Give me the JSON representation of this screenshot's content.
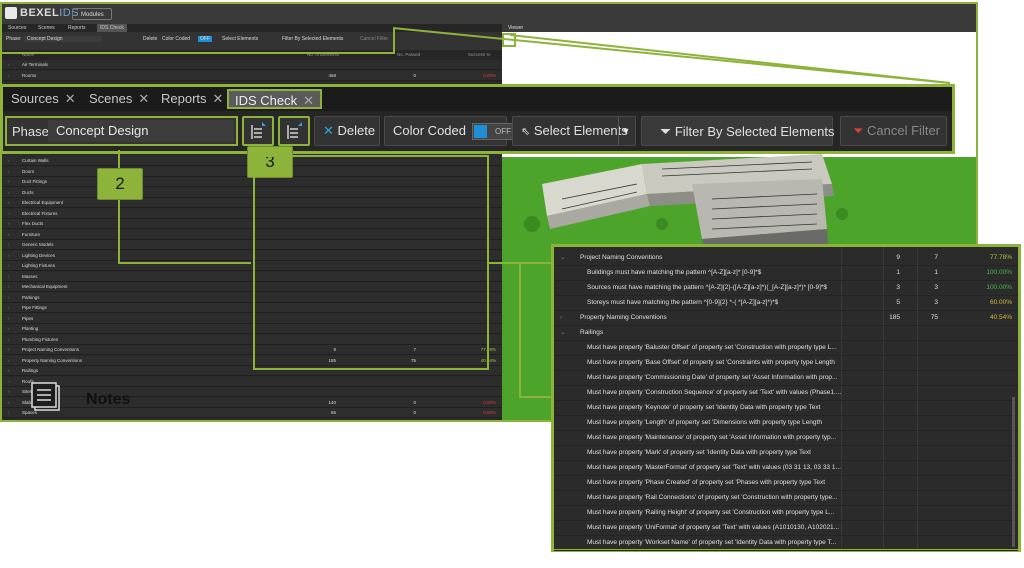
{
  "app": {
    "logo_main": "BEXEL",
    "logo_sub": "IDS",
    "module_button": "Modules",
    "small_tabs": [
      "Sources",
      "Scenes",
      "Reports",
      "IDS Check"
    ],
    "viewer_tab": "Viewer",
    "small_toolbar": {
      "phase_label": "Phase:",
      "phase_value": "Concept Design",
      "delete": "Delete",
      "color_coded": "Color Coded",
      "off": "OFF",
      "select_elements": "Select Elements",
      "filter": "Filter By Selected Elements",
      "cancel_filter": "Cancel Filter"
    },
    "small_header": {
      "name": "Name",
      "elements": "No. of Elements",
      "passed": "No. Passed",
      "success": "Success %"
    },
    "top_rows": [
      {
        "label": "Air Terminals",
        "a": "",
        "b": "",
        "p": ""
      },
      {
        "label": "Rooms",
        "a": "468",
        "b": "0",
        "p": "0.00%"
      }
    ],
    "categories": [
      {
        "label": "Curtain Walls",
        "a": "",
        "b": "",
        "p": ""
      },
      {
        "label": "Doors",
        "a": "",
        "b": "",
        "p": ""
      },
      {
        "label": "Duct Fittings",
        "a": "",
        "b": "",
        "p": ""
      },
      {
        "label": "Ducts",
        "a": "",
        "b": "",
        "p": ""
      },
      {
        "label": "Electrical Equipment",
        "a": "",
        "b": "",
        "p": ""
      },
      {
        "label": "Electrical Fixtures",
        "a": "",
        "b": "",
        "p": ""
      },
      {
        "label": "Flex Ducts",
        "a": "",
        "b": "",
        "p": ""
      },
      {
        "label": "Furniture",
        "a": "",
        "b": "",
        "p": ""
      },
      {
        "label": "Generic Models",
        "a": "",
        "b": "",
        "p": ""
      },
      {
        "label": "Lighting Devices",
        "a": "",
        "b": "",
        "p": ""
      },
      {
        "label": "Lighting Fixtures",
        "a": "",
        "b": "",
        "p": ""
      },
      {
        "label": "Masses",
        "a": "",
        "b": "",
        "p": ""
      },
      {
        "label": "Mechanical Equipment",
        "a": "",
        "b": "",
        "p": ""
      },
      {
        "label": "Parkings",
        "a": "",
        "b": "",
        "p": ""
      },
      {
        "label": "Pipe Fittings",
        "a": "",
        "b": "",
        "p": ""
      },
      {
        "label": "Pipes",
        "a": "",
        "b": "",
        "p": ""
      },
      {
        "label": "Planting",
        "a": "",
        "b": "",
        "p": ""
      },
      {
        "label": "Plumbing Fixtures",
        "a": "",
        "b": "",
        "p": ""
      },
      {
        "label": "Project Naming Conventions",
        "a": "9",
        "b": "7",
        "p": "77.78%"
      },
      {
        "label": "Property Naming Conventions",
        "a": "185",
        "b": "75",
        "p": "40.54%"
      },
      {
        "label": "Railings",
        "a": "",
        "b": "",
        "p": ""
      },
      {
        "label": "Roofs",
        "a": "",
        "b": "",
        "p": ""
      },
      {
        "label": "Sites",
        "a": "",
        "b": "",
        "p": ""
      },
      {
        "label": "Slabs",
        "a": "140",
        "b": "0",
        "p": "0.00%"
      },
      {
        "label": "Spaces",
        "a": "65",
        "b": "0",
        "p": "0.00%"
      }
    ]
  },
  "toolbar": {
    "tabs": [
      "Sources",
      "Scenes",
      "Reports",
      "IDS Check"
    ],
    "phase_label": "Phase:",
    "phase_value": "Concept Design",
    "delete": "Delete",
    "color_coded": "Color Coded",
    "toggle_state": "OFF",
    "select_elements": "Select Elements",
    "filter": "Filter By Selected Elements",
    "cancel_filter": "Cancel Filter"
  },
  "callouts": {
    "two": "2",
    "three": "3"
  },
  "panel": {
    "rows": [
      {
        "indent": 0,
        "label": "Project Naming Conventions",
        "a": "9",
        "b": "7",
        "p": "77.78%",
        "pcolor": "#a6c83c"
      },
      {
        "indent": 1,
        "label": "Buildings must have matching the pattern ^[A-Z][a-z]* [0-9]*$",
        "a": "1",
        "b": "1",
        "p": "100.00%",
        "pcolor": "#4cb748"
      },
      {
        "indent": 1,
        "label": "Sources must have matching the pattern ^[A-Z]{2}-([A-Z][a-z]*)(_[A-Z][a-z]*)* [0-9]*$",
        "a": "3",
        "b": "3",
        "p": "100.00%",
        "pcolor": "#4cb748"
      },
      {
        "indent": 1,
        "label": "Storeys must have matching the pattern ^[0-9]{2} *-( *[A-Z][a-z]*)*$",
        "a": "5",
        "b": "3",
        "p": "60.00%",
        "pcolor": "#d6b93a"
      },
      {
        "indent": 0,
        "label": "Property Naming Conventions",
        "a": "185",
        "b": "75",
        "p": "40.54%",
        "pcolor": "#d6b93a"
      },
      {
        "indent": 0,
        "label": "Railings",
        "a": "",
        "b": "",
        "p": "",
        "pcolor": "#ffffff"
      },
      {
        "indent": 1,
        "label": "Must have property 'Baluster Offset' of property set 'Construction with property type L...",
        "a": "",
        "b": "",
        "p": "",
        "pcolor": "#ffffff"
      },
      {
        "indent": 1,
        "label": "Must have property 'Base Offset' of property set 'Constraints with property type Length",
        "a": "",
        "b": "",
        "p": "",
        "pcolor": "#ffffff"
      },
      {
        "indent": 1,
        "label": "Must have property 'Commissioning Date' of property set 'Asset Information with prop...",
        "a": "",
        "b": "",
        "p": "",
        "pcolor": "#ffffff"
      },
      {
        "indent": 1,
        "label": "Must have property 'Construction Sequence' of property set 'Text' with values (Phase1....",
        "a": "",
        "b": "",
        "p": "",
        "pcolor": "#ffffff"
      },
      {
        "indent": 1,
        "label": "Must have property 'Keynote' of property set 'Identity Data with property type Text",
        "a": "",
        "b": "",
        "p": "",
        "pcolor": "#ffffff"
      },
      {
        "indent": 1,
        "label": "Must have property 'Length' of property set 'Dimensions with property type Length",
        "a": "",
        "b": "",
        "p": "",
        "pcolor": "#ffffff"
      },
      {
        "indent": 1,
        "label": "Must have property 'Maintenance' of property set 'Asset Information with property typ...",
        "a": "",
        "b": "",
        "p": "",
        "pcolor": "#ffffff"
      },
      {
        "indent": 1,
        "label": "Must have property 'Mark' of property set 'Identity Data with property type Text",
        "a": "",
        "b": "",
        "p": "",
        "pcolor": "#ffffff"
      },
      {
        "indent": 1,
        "label": "Must have property 'MasterFormat' of property set 'Text' with values (03 31 13, 03 33 1...",
        "a": "",
        "b": "",
        "p": "",
        "pcolor": "#ffffff"
      },
      {
        "indent": 1,
        "label": "Must have property 'Phase Created' of property set 'Phases with property type Text",
        "a": "",
        "b": "",
        "p": "",
        "pcolor": "#ffffff"
      },
      {
        "indent": 1,
        "label": "Must have property 'Rail Connections' of property set 'Construction with property type...",
        "a": "",
        "b": "",
        "p": "",
        "pcolor": "#ffffff"
      },
      {
        "indent": 1,
        "label": "Must have property 'Railing Height' of property set 'Construction with property type L...",
        "a": "",
        "b": "",
        "p": "",
        "pcolor": "#ffffff"
      },
      {
        "indent": 1,
        "label": "Must have property 'UniFormat' of property set 'Text' with values (A1010130, A102021...",
        "a": "",
        "b": "",
        "p": "",
        "pcolor": "#ffffff"
      },
      {
        "indent": 1,
        "label": "Must have property 'Workset Name' of property set 'Identity Data with property type T...",
        "a": "",
        "b": "",
        "p": "",
        "pcolor": "#ffffff"
      }
    ]
  },
  "notes": {
    "label": "Notes"
  },
  "colors": {
    "accent": "#8db33a",
    "grass": "#4da42a",
    "panel": "#2b2b2b",
    "toggle": "#1f8fd8"
  }
}
